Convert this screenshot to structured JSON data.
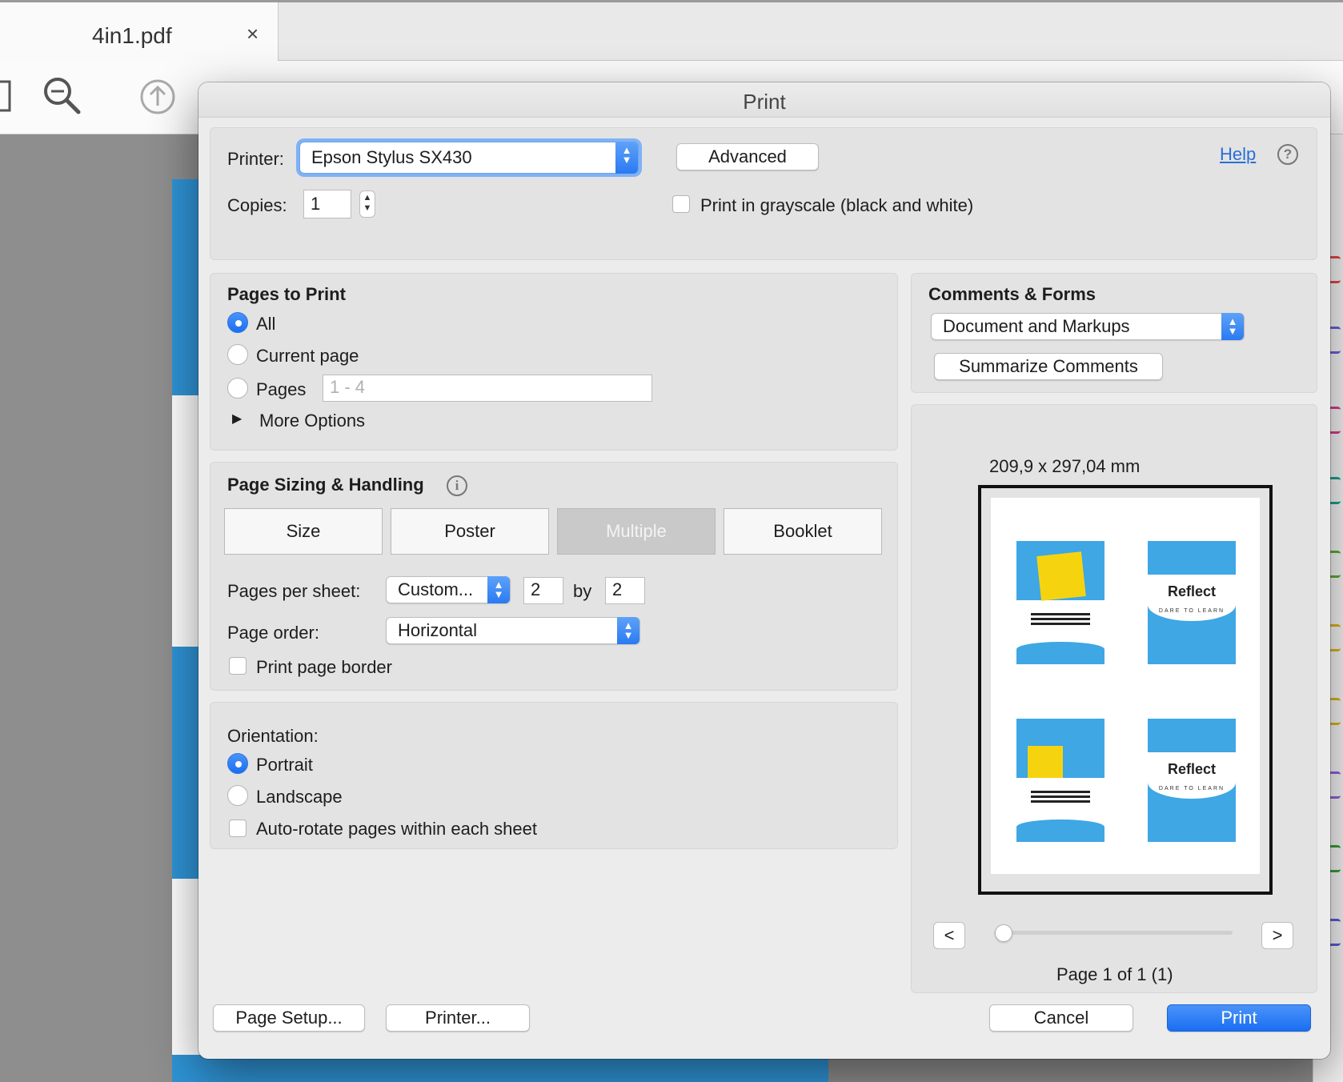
{
  "app": {
    "tab_title": "4in1.pdf",
    "tab_close": "×"
  },
  "dialog": {
    "title": "Print",
    "printer": {
      "label": "Printer:",
      "selected": "Epson Stylus SX430",
      "advanced_button": "Advanced",
      "help_link": "Help",
      "help_icon": "?"
    },
    "copies": {
      "label": "Copies:",
      "value": "1"
    },
    "grayscale": {
      "label": "Print in grayscale (black and white)",
      "checked": false
    },
    "pages_to_print": {
      "heading": "Pages to Print",
      "options": [
        {
          "label": "All",
          "selected": true
        },
        {
          "label": "Current page",
          "selected": false
        },
        {
          "label": "Pages",
          "selected": false
        }
      ],
      "pages_placeholder": "1 - 4",
      "more_options": "More Options"
    },
    "page_sizing": {
      "heading": "Page Sizing & Handling",
      "info_icon": "i",
      "modes": [
        "Size",
        "Poster",
        "Multiple",
        "Booklet"
      ],
      "selected_mode": "Multiple",
      "pages_per_sheet_label": "Pages per sheet:",
      "pages_per_sheet_value": "Custom...",
      "cols": "2",
      "by_label": "by",
      "rows": "2",
      "page_order_label": "Page order:",
      "page_order_value": "Horizontal",
      "border_label": "Print page border"
    },
    "orientation": {
      "heading": "Orientation:",
      "options": [
        {
          "label": "Portrait",
          "selected": true
        },
        {
          "label": "Landscape",
          "selected": false
        }
      ],
      "auto_rotate_label": "Auto-rotate pages within each sheet"
    },
    "comments_forms": {
      "heading": "Comments & Forms",
      "selected": "Document and Markups",
      "summarize_button": "Summarize Comments"
    },
    "preview": {
      "dimensions": "209,9 x 297,04 mm",
      "thumb_word": "Reflect",
      "thumb_sub": "DARE TO LEARN",
      "prev": "<",
      "next": ">",
      "page_status": "Page 1 of 1 (1)"
    },
    "buttons": {
      "page_setup": "Page Setup...",
      "printer": "Printer...",
      "cancel": "Cancel",
      "print": "Print"
    }
  }
}
